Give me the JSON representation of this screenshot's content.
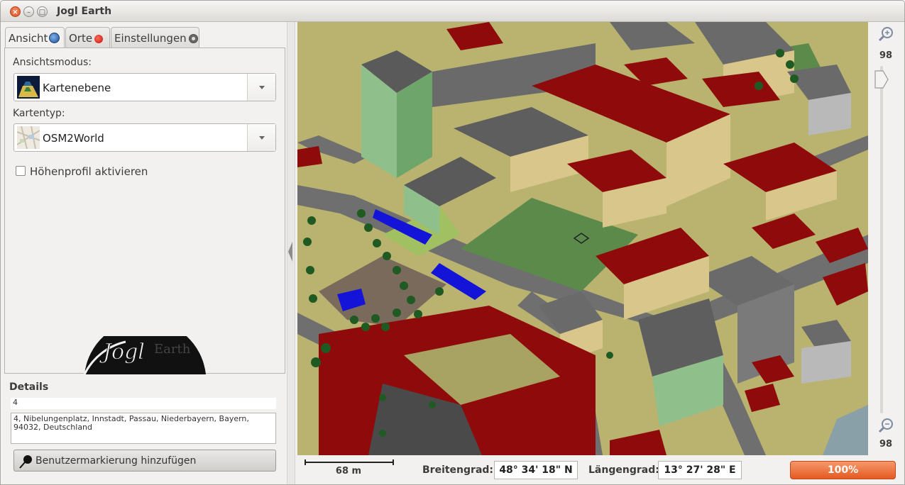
{
  "window": {
    "title": "Jogl Earth"
  },
  "tabs": [
    {
      "label": "Ansicht",
      "icon": "globe-icon"
    },
    {
      "label": "Orte",
      "icon": "pin-icon"
    },
    {
      "label": "Einstellungen",
      "icon": "gear-icon"
    }
  ],
  "view": {
    "mode_label": "Ansichtsmodus:",
    "mode_value": "Kartenebene",
    "maptype_label": "Kartentyp:",
    "maptype_value": "OSM2World",
    "elevation_label": "Höhenprofil aktivieren",
    "elevation_checked": false,
    "logo_text": "Jogl Earth"
  },
  "details": {
    "title": "Details",
    "number": "4",
    "address": "4, Nibelungenplatz, Innstadt, Passau, Niederbayern, Bayern, 94032, Deutschland"
  },
  "marker_button": {
    "label": "Benutzermarkierung hinzufügen",
    "icon": "pin-icon"
  },
  "zoom": {
    "top_value": "98",
    "bottom_value": "98"
  },
  "status": {
    "scale_label": "68 m",
    "lat_label": "Breitengrad:",
    "lat_value": "48° 34' 18\" N",
    "lon_label": "Längengrad:",
    "lon_value": "13° 27' 28\" E",
    "progress_text": "100%",
    "progress_fraction": 1.0
  },
  "colors": {
    "accent": "#e45a22",
    "roof": "#8f0a0a",
    "grass": "#8ea65a"
  }
}
